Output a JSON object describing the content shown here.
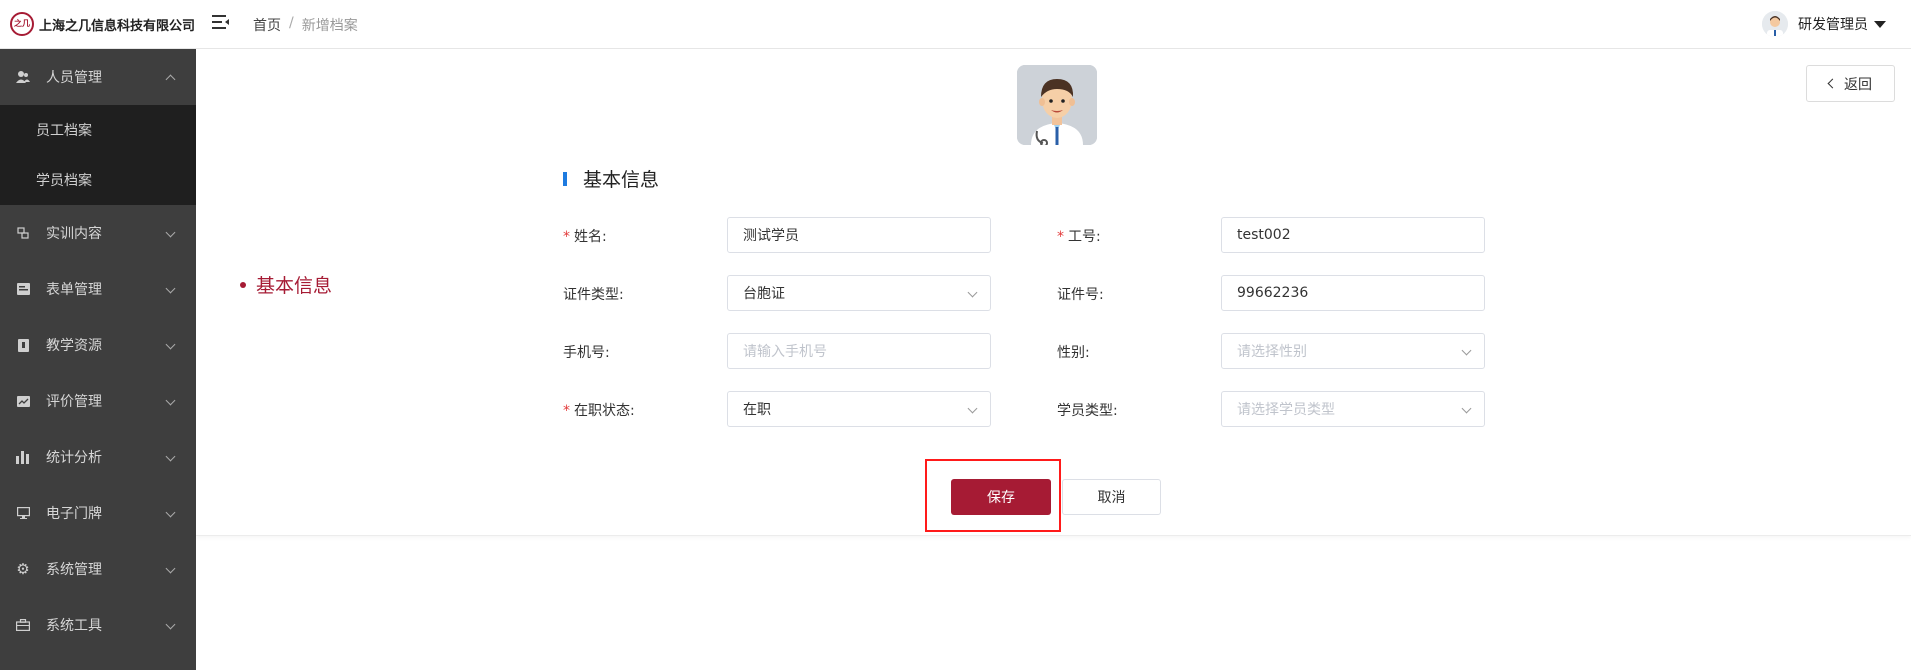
{
  "header": {
    "company": "上海之几信息科技有限公司",
    "logo_mark": "之几",
    "breadcrumb": {
      "home": "首页",
      "separator": "/",
      "current": "新增档案"
    },
    "user_name": "研发管理员"
  },
  "sidebar": {
    "items": [
      {
        "label": "人员管理",
        "icon": "people-icon",
        "expanded": true,
        "children": [
          {
            "label": "员工档案"
          },
          {
            "label": "学员档案"
          }
        ]
      },
      {
        "label": "实训内容",
        "icon": "training-icon"
      },
      {
        "label": "表单管理",
        "icon": "form-icon"
      },
      {
        "label": "教学资源",
        "icon": "resource-icon"
      },
      {
        "label": "评价管理",
        "icon": "evaluation-icon"
      },
      {
        "label": "统计分析",
        "icon": "chart-icon"
      },
      {
        "label": "电子门牌",
        "icon": "monitor-icon"
      },
      {
        "label": "系统管理",
        "icon": "gear-icon"
      },
      {
        "label": "系统工具",
        "icon": "toolbox-icon"
      }
    ]
  },
  "main": {
    "back_label": "返回",
    "anchor_label": "基本信息",
    "section_title": "基本信息",
    "form": {
      "name": {
        "label": "姓名:",
        "required": true,
        "value": "测试学员"
      },
      "employee_no": {
        "label": "工号:",
        "required": true,
        "value": "test002"
      },
      "id_type": {
        "label": "证件类型:",
        "value": "台胞证"
      },
      "id_no": {
        "label": "证件号:",
        "value": "99662236"
      },
      "phone": {
        "label": "手机号:",
        "placeholder": "请输入手机号"
      },
      "gender": {
        "label": "性别:",
        "placeholder": "请选择性别"
      },
      "job_status": {
        "label": "在职状态:",
        "required": true,
        "value": "在职"
      },
      "student_type": {
        "label": "学员类型:",
        "placeholder": "请选择学员类型"
      }
    },
    "save_label": "保存",
    "cancel_label": "取消"
  },
  "colors": {
    "brand": "#a61b34",
    "sidebar_bg": "#3e3e3e",
    "submenu_bg": "#1f1f1f",
    "section_accent": "#1e7be0",
    "highlight": "#ff1a1a"
  }
}
